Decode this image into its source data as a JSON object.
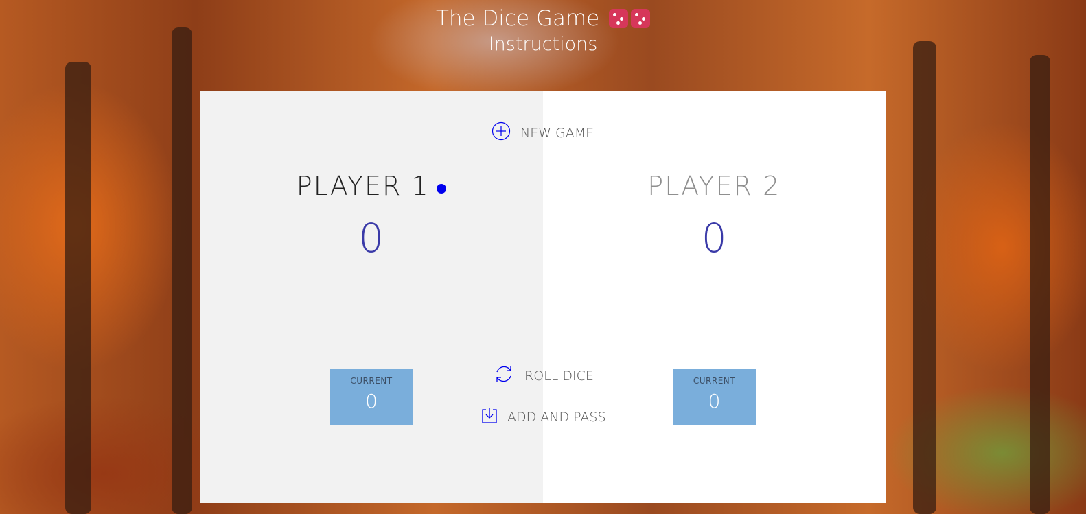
{
  "header": {
    "title": "The Dice Game",
    "dice_icons": [
      "dice-icon",
      "dice-icon"
    ],
    "instructions_link": "Instructions"
  },
  "players": [
    {
      "name": "PLAYER 1",
      "score": "0",
      "current_label": "CURRENT",
      "current_score": "0",
      "active": true
    },
    {
      "name": "PLAYER 2",
      "score": "0",
      "current_label": "CURRENT",
      "current_score": "0",
      "active": false
    }
  ],
  "controls": {
    "new_game": "NEW GAME",
    "roll_dice": "ROLL DICE",
    "add_and_pass": "ADD AND PASS"
  },
  "colors": {
    "accent": "#0000ee",
    "current_box": "#7aaedb",
    "active_panel": "#f2f2f2",
    "inactive_panel": "#ffffff"
  }
}
